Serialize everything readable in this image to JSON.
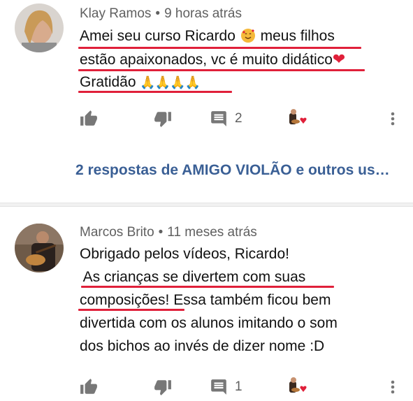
{
  "comments": [
    {
      "author": "Klay Ramos",
      "time": "9 horas atrás",
      "lines": [
        "Amei seu curso Ricardo",
        "meus filhos",
        "estão apaixonados, vc é muito didático",
        "Gratidão"
      ],
      "reply_count": "2",
      "replies_link": "2 respostas de AMIGO VIOLÃO e outros us…"
    },
    {
      "author": "Marcos Brito",
      "time": "11 meses atrás",
      "lines": [
        "Obrigado pelos vídeos, Ricardo!",
        " As crianças se divertem com suas",
        "composições!",
        " Essa também ficou bem",
        "divertida com os alunos imitando o som",
        "dos bichos ao invés de dizer nome :D"
      ],
      "reply_count": "1"
    }
  ],
  "meta_separator": "•",
  "colors": {
    "link": "#3a5f95",
    "underline": "#e0203a",
    "meta": "#606060"
  },
  "icons": [
    "thumbs-up-icon",
    "thumbs-down-icon",
    "reply-icon",
    "creator-heart-icon",
    "more-vert-icon"
  ]
}
